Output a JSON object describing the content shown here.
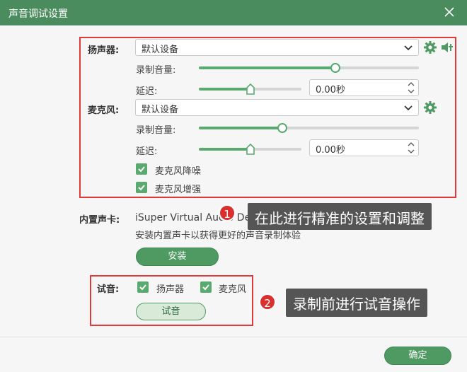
{
  "window": {
    "title": "声音调试设置"
  },
  "speaker": {
    "label": "扬声器:",
    "device": "默认设备",
    "volume_label": "录制音量:",
    "volume_value": 0.62,
    "delay_label": "延迟:",
    "delay_value": "0.00秒",
    "delay_slider_value": 0.5
  },
  "mic": {
    "label": "麦克风:",
    "device": "默认设备",
    "volume_label": "录制音量:",
    "volume_value": 0.38,
    "delay_label": "延迟:",
    "delay_value": "0.00秒",
    "delay_slider_value": 0.5,
    "noise_reduction_label": "麦克风降噪",
    "enhance_label": "麦克风增强"
  },
  "builtin_card": {
    "label": "内置声卡:",
    "device_name": "iSuper Virtual Audio Device",
    "hint": "安装内置声卡以获得更好的声音录制体验",
    "install_label": "安装"
  },
  "test": {
    "label": "试音:",
    "speaker_label": "扬声器",
    "mic_label": "麦克风",
    "button_label": "试音"
  },
  "callouts": {
    "one_number": "1",
    "one_text": "在此进行精准的设置和调整",
    "two_number": "2",
    "two_text": "录制前进行试音操作"
  },
  "footer": {
    "ok_label": "确定"
  },
  "colors": {
    "accent": "#4a8c5e",
    "highlight": "#e03a3a",
    "callout_bg": "#555555"
  }
}
